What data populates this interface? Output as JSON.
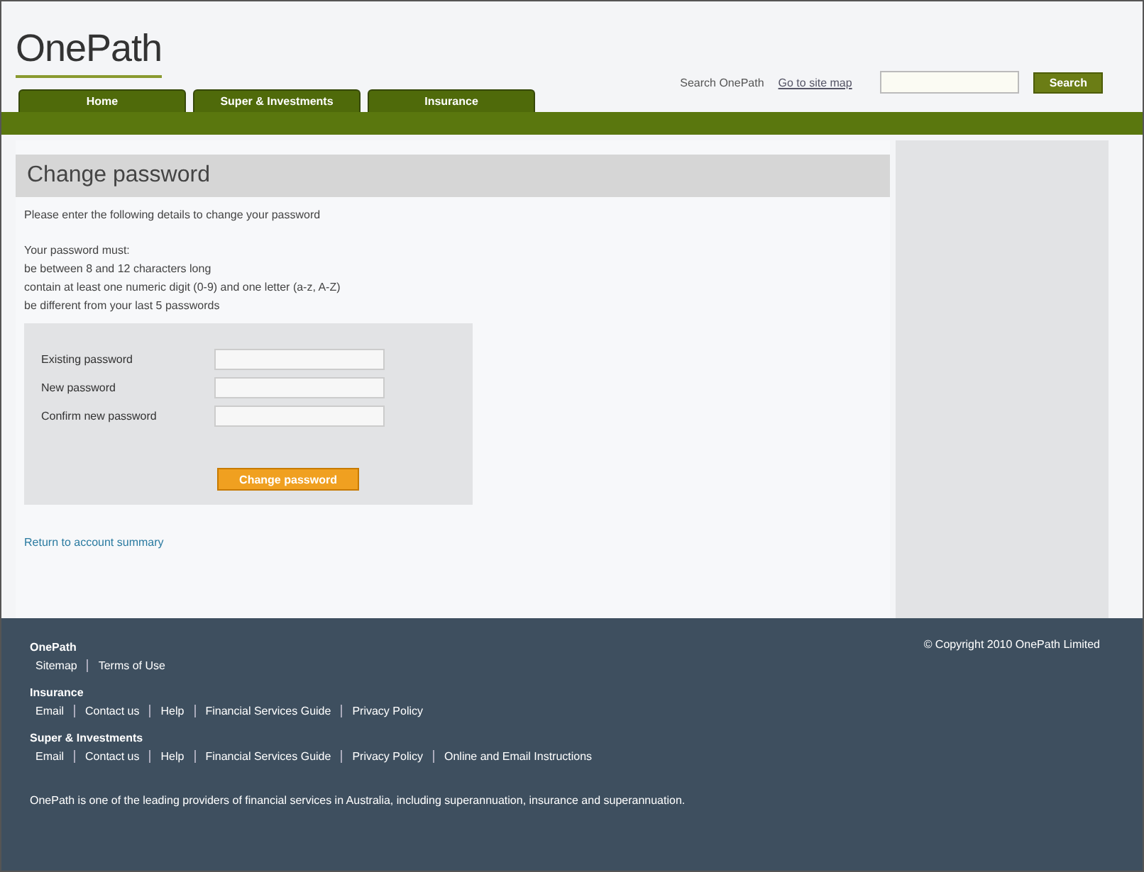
{
  "header": {
    "logo": "OnePath",
    "search_label": "Search OnePath",
    "site_map_link": "Go to site map",
    "search_button": "Search"
  },
  "tabs": [
    {
      "label": "Home",
      "selected": false
    },
    {
      "label": "Super & Investments",
      "selected": false
    },
    {
      "label": "Insurance",
      "selected": false
    }
  ],
  "main": {
    "title": "Change password",
    "intro": "Please enter the following details to change your password",
    "rules_heading": "Your password must:",
    "rules": [
      "be between 8 and 12 characters long",
      "contain at least one numeric digit (0-9) and one letter (a-z, A-Z)",
      "be different from your last 5 passwords"
    ],
    "fields": [
      {
        "label": "Existing password"
      },
      {
        "label": "New password"
      },
      {
        "label": "Confirm new password"
      }
    ],
    "submit": "Change password",
    "back_link": "Return to account summary"
  },
  "footer": {
    "copyright": "© Copyright 2010 OnePath Limited",
    "sections": [
      {
        "heading": "OnePath",
        "links": [
          "Sitemap",
          "Terms of Use"
        ]
      },
      {
        "heading": "Insurance",
        "links": [
          "Email",
          "Contact us",
          "Help",
          "Financial Services Guide",
          "Privacy Policy"
        ]
      },
      {
        "heading": "Super & Investments",
        "links": [
          "Email",
          "Contact us",
          "Help",
          "Financial Services Guide",
          "Privacy Policy",
          "Online and Email Instructions"
        ]
      }
    ],
    "about": "OnePath is one of the leading providers of financial services in Australia, including superannuation, insurance and superannuation."
  }
}
